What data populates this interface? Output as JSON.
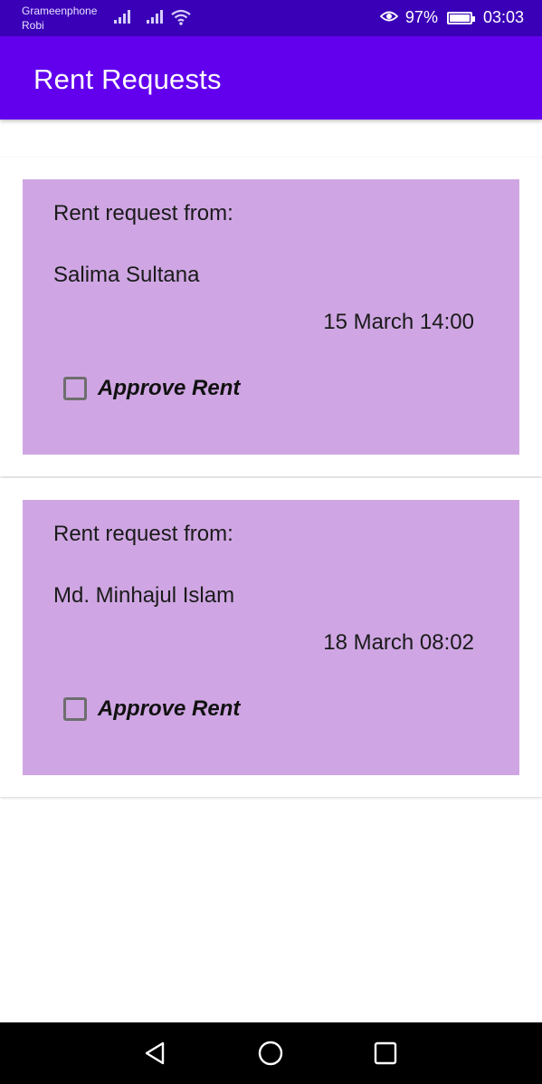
{
  "status_bar": {
    "carrier_1": "Grameenphone",
    "carrier_2": "Robi",
    "battery_percent": "97%",
    "battery_level": 0.97,
    "time": "03:03",
    "icons": [
      "signal-icon",
      "signal-icon",
      "wifi-icon",
      "eye-icon",
      "battery-icon"
    ]
  },
  "app_bar": {
    "title": "Rent Requests",
    "color": "#6200ee"
  },
  "requests": [
    {
      "label": "Rent request from:",
      "requester": "Salima Sultana",
      "datetime": "15 March 14:00",
      "approve_label": "Approve Rent",
      "approved": false
    },
    {
      "label": "Rent request from:",
      "requester": "Md. Minhajul Islam",
      "datetime": "18 March 08:02",
      "approve_label": "Approve Rent",
      "approved": false
    }
  ],
  "card_color": "#cfa6e3",
  "nav_bar": {
    "icons": [
      "back-icon",
      "home-icon",
      "recents-icon"
    ]
  }
}
